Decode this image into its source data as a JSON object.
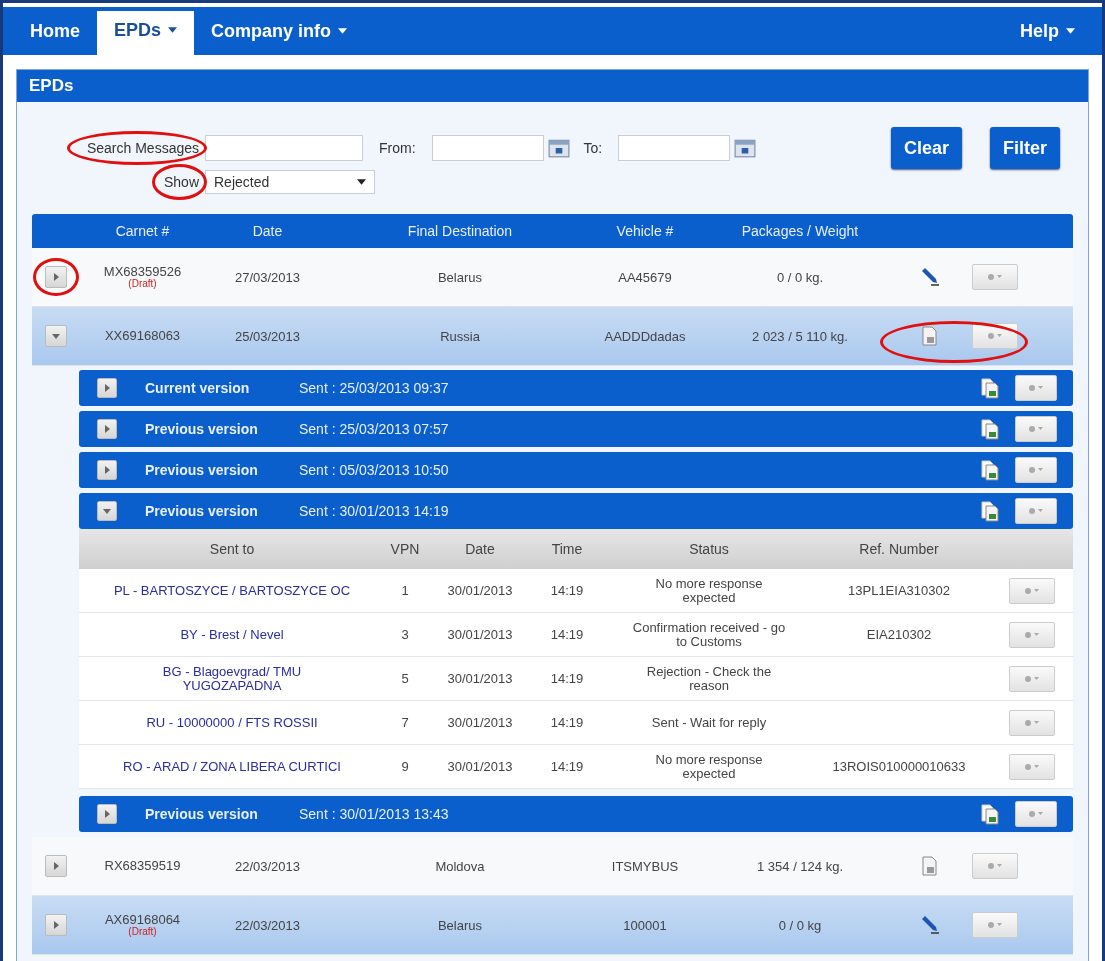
{
  "nav": {
    "tabs": [
      {
        "label": "Home",
        "selected": false,
        "dropdown": false
      },
      {
        "label": "EPDs",
        "selected": true,
        "dropdown": true
      },
      {
        "label": "Company info",
        "selected": false,
        "dropdown": true
      }
    ],
    "help": {
      "label": "Help",
      "dropdown": true
    }
  },
  "panel": {
    "title": "EPDs"
  },
  "filters": {
    "search": {
      "label": "Search Messages",
      "circled": true
    },
    "from": {
      "label": "From:"
    },
    "to": {
      "label": "To:"
    },
    "show": {
      "label": "Show",
      "value": "Rejected",
      "circled": true
    },
    "buttons": [
      "Clear",
      "Filter"
    ]
  },
  "table": {
    "columns": [
      "Carnet #",
      "Date",
      "Final Destination",
      "Vehicle #",
      "Packages / Weight"
    ],
    "rows": [
      {
        "carnet": "MX68359526",
        "draft_label": "(Draft)",
        "date": "27/03/2013",
        "destination": "Belarus",
        "vehicle": "AA45679",
        "packages": "0 / 0 kg.",
        "kind": "draft",
        "expanded": false,
        "selected": false,
        "toggle_circled": true,
        "actions_circled": false,
        "versions": []
      },
      {
        "carnet": "XX69168063",
        "date": "25/03/2013",
        "destination": "Russia",
        "vehicle": "AADDDdadas",
        "packages": "2 023 / 5 110 kg.",
        "kind": "sent",
        "expanded": true,
        "selected": true,
        "toggle_circled": false,
        "actions_circled": true,
        "versions": [
          {
            "label": "Current version",
            "sent": "Sent : 25/03/2013 09:37",
            "expanded": false
          },
          {
            "label": "Previous version",
            "sent": "Sent : 25/03/2013 07:57",
            "expanded": false
          },
          {
            "label": "Previous version",
            "sent": "Sent : 05/03/2013 10:50",
            "expanded": false
          },
          {
            "label": "Previous version",
            "sent": "Sent : 30/01/2013 14:19",
            "expanded": true,
            "details": {
              "columns": [
                "Sent to",
                "VPN",
                "Date",
                "Time",
                "Status",
                "Ref. Number"
              ],
              "rows": [
                {
                  "sent_to": "PL - BARTOSZYCE / BARTOSZYCE OC",
                  "vpn": "1",
                  "date": "30/01/2013",
                  "time": "14:19",
                  "status": "No more response expected",
                  "ref": "13PL1EIA310302"
                },
                {
                  "sent_to": "BY - Brest / Nevel",
                  "vpn": "3",
                  "date": "30/01/2013",
                  "time": "14:19",
                  "status": "Confirmation received - go to Customs",
                  "ref": "EIA210302"
                },
                {
                  "sent_to": "BG - Blagoevgrad/ TMU YUGOZAPADNA",
                  "vpn": "5",
                  "date": "30/01/2013",
                  "time": "14:19",
                  "status": "Rejection - Check the reason",
                  "ref": ""
                },
                {
                  "sent_to": "RU - 10000000 / FTS ROSSII",
                  "vpn": "7",
                  "date": "30/01/2013",
                  "time": "14:19",
                  "status": "Sent - Wait for reply",
                  "ref": ""
                },
                {
                  "sent_to": "RO - ARAD / ZONA LIBERA CURTICI",
                  "vpn": "9",
                  "date": "30/01/2013",
                  "time": "14:19",
                  "status": "No more response expected",
                  "ref": "13ROIS010000010633"
                }
              ]
            }
          },
          {
            "label": "Previous version",
            "sent": "Sent : 30/01/2013 13:43",
            "expanded": false
          }
        ]
      },
      {
        "carnet": "RX68359519",
        "date": "22/03/2013",
        "destination": "Moldova",
        "vehicle": "ITSMYBUS",
        "packages": "1 354 / 124 kg.",
        "kind": "sent",
        "expanded": false,
        "selected": false,
        "toggle_circled": false,
        "actions_circled": false,
        "versions": []
      },
      {
        "carnet": "AX69168064",
        "draft_label": "(Draft)",
        "date": "22/03/2013",
        "destination": "Belarus",
        "vehicle": "100001",
        "packages": "0 / 0 kg",
        "kind": "draft",
        "expanded": false,
        "selected": true,
        "toggle_circled": false,
        "actions_circled": false,
        "versions": []
      }
    ]
  }
}
